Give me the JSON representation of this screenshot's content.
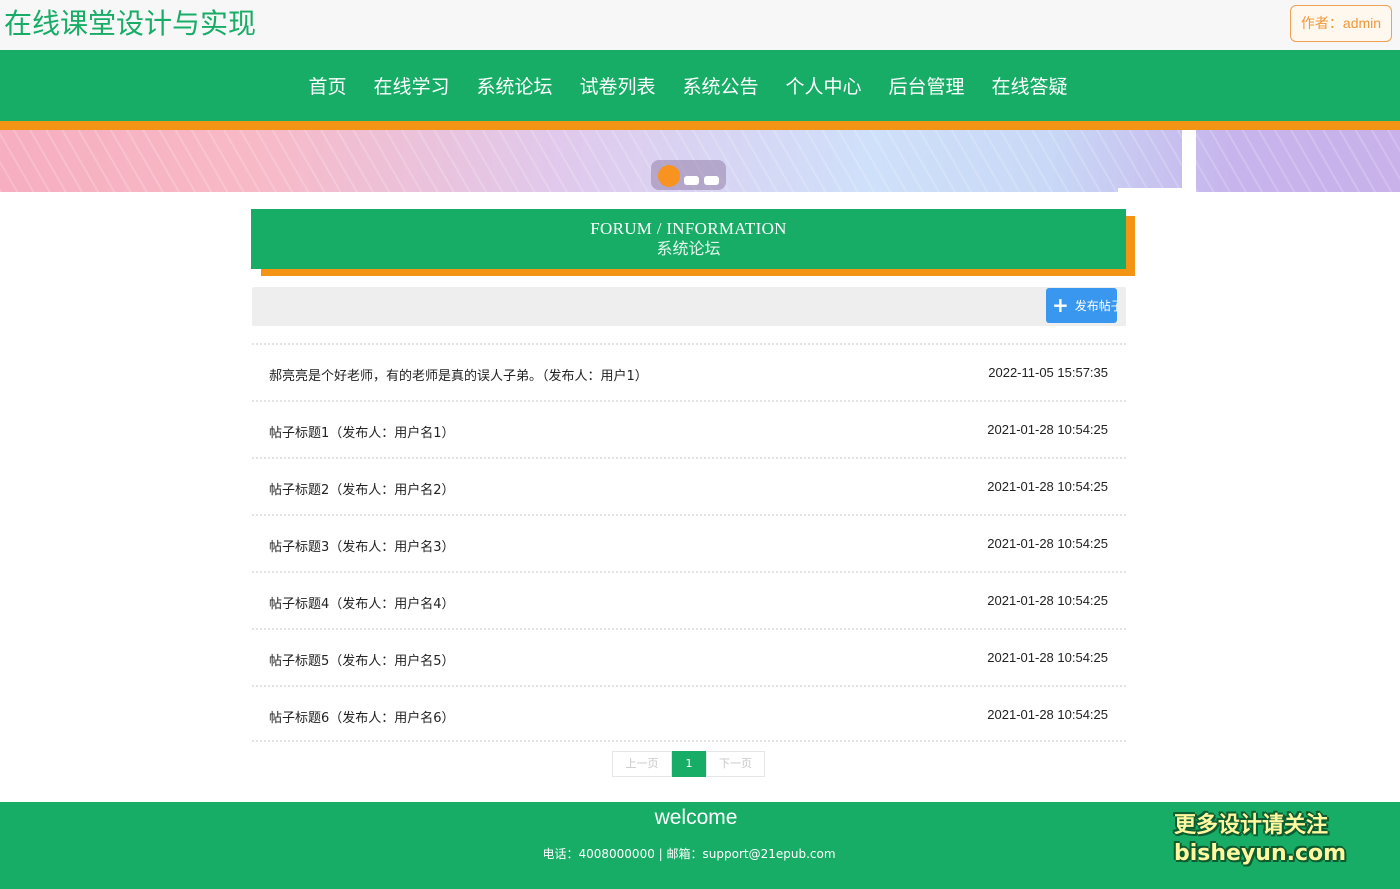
{
  "header": {
    "site_title": "在线课堂设计与实现",
    "author_label": "作者：admin"
  },
  "nav": {
    "items": [
      "首页",
      "在线学习",
      "系统论坛",
      "试卷列表",
      "系统公告",
      "个人中心",
      "后台管理",
      "在线答疑"
    ]
  },
  "section": {
    "title_en": "FORUM / INFORMATION",
    "title_cn": "系统论坛"
  },
  "toolbar": {
    "post_button_label": "发布帖子"
  },
  "posts": [
    {
      "title": "郝亮亮是个好老师，有的老师是真的误人子弟。（发布人：用户1）",
      "time": "2022-11-05 15:57:35"
    },
    {
      "title": "帖子标题1（发布人：用户名1）",
      "time": "2021-01-28 10:54:25"
    },
    {
      "title": "帖子标题2（发布人：用户名2）",
      "time": "2021-01-28 10:54:25"
    },
    {
      "title": "帖子标题3（发布人：用户名3）",
      "time": "2021-01-28 10:54:25"
    },
    {
      "title": "帖子标题4（发布人：用户名4）",
      "time": "2021-01-28 10:54:25"
    },
    {
      "title": "帖子标题5（发布人：用户名5）",
      "time": "2021-01-28 10:54:25"
    },
    {
      "title": "帖子标题6（发布人：用户名6）",
      "time": "2021-01-28 10:54:25"
    }
  ],
  "pagination": {
    "prev_label": "上一页",
    "current_page": "1",
    "next_label": "下一页"
  },
  "footer": {
    "welcome": "welcome",
    "contact": "电话：4008000000 | 邮箱：support@21epub.com",
    "watermark_line1": "更多设计请关注",
    "watermark_line2": "bisheyun.com"
  },
  "colors": {
    "primary_green": "#17ad67",
    "accent_orange": "#f39414",
    "button_blue": "#3a97ef"
  },
  "banner": {
    "slide_count": 3,
    "active_slide": 1
  }
}
